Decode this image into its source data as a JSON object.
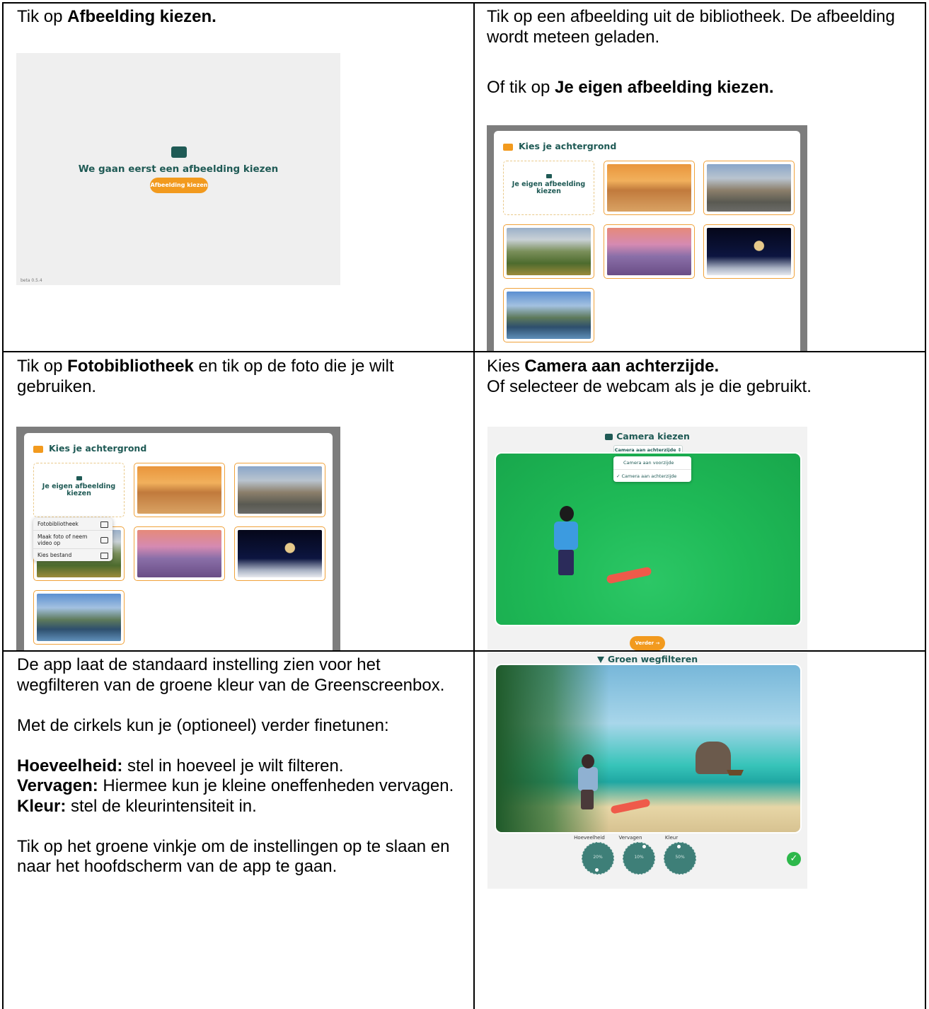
{
  "row1": {
    "left_text": {
      "pre": "Tik op ",
      "bold": "Afbeelding kiezen."
    },
    "right_text": {
      "line1": "Tik op een afbeelding uit de bibliotheek. De afbeelding wordt meteen geladen.",
      "line2_pre": "Of tik op ",
      "line2_bold": "Je eigen afbeelding kiezen."
    }
  },
  "row2": {
    "left_text": {
      "pre": "Tik op ",
      "bold": "Fotobibliotheek",
      "post": " en tik op de foto die je wilt gebruiken."
    },
    "right_text": {
      "pre": "Kies ",
      "bold": "Camera aan achterzijde.",
      "line2": "Of selecteer de webcam als je die gebruikt."
    }
  },
  "row3": {
    "left_text": {
      "p1": "De app laat de standaard instelling zien voor het wegfilteren van de groene kleur van de Greenscreenbox.",
      "p2": "Met de cirkels kun je (optioneel) verder finetunen:",
      "b1_label": "Hoeveelheid:",
      "b1_text": " stel in hoeveel je wilt filteren.",
      "b2_label": "Vervagen:",
      "b2_text": " Hiermee kun je kleine oneffenheden vervagen.",
      "b3_label": "Kleur:",
      "b3_text": " stel de kleurintensiteit in.",
      "p3": "Tik op het groene vinkje om de instellingen op te slaan en naar het hoofdscherm van de app te gaan."
    }
  },
  "screen_start": {
    "title": "We gaan eerst een afbeelding kiezen",
    "button": "Afbeelding kiezen",
    "version": "beta 0.5.4"
  },
  "background_picker": {
    "header": "Kies je achtergrond",
    "own_image": "Je eigen afbeelding kiezen"
  },
  "file_menu": {
    "items": [
      "Fotobibliotheek",
      "Maak foto of neem video op",
      "Kies bestand"
    ]
  },
  "camera_screen": {
    "title": "Camera kiezen",
    "select_value": "Camera aan achterzijde",
    "options": [
      "Camera aan voorzijde",
      "✓ Camera aan achterzijde"
    ],
    "next_button": "Verder →"
  },
  "filter_screen": {
    "title": "Groen wegfilteren",
    "dials": [
      {
        "label": "Hoeveelheid",
        "value": "20%"
      },
      {
        "label": "Vervagen",
        "value": "10%"
      },
      {
        "label": "Kleur",
        "value": "50%"
      }
    ]
  },
  "colors": {
    "teal": "#1f5a55",
    "orange": "#f29a1e",
    "check_green": "#2db84b"
  }
}
